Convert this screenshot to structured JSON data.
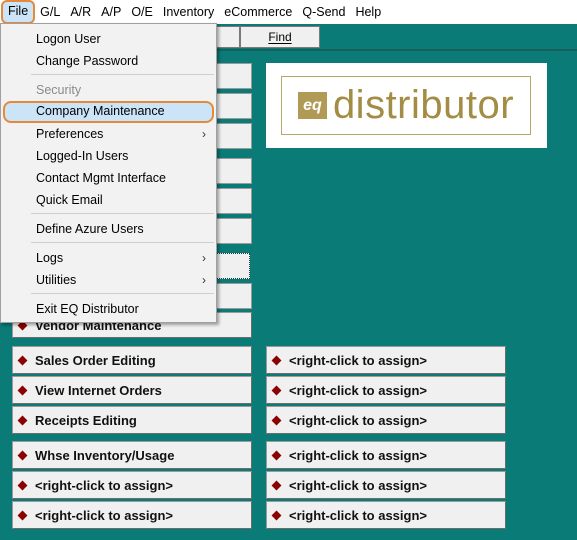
{
  "menubar": {
    "items": [
      "File",
      "G/L",
      "A/R",
      "A/P",
      "O/E",
      "Inventory",
      "eCommerce",
      "Q-Send",
      "Help"
    ]
  },
  "toolbar": {
    "find_label": "Find"
  },
  "logo": {
    "mark": "eq",
    "text": "distributor"
  },
  "file_menu": {
    "items": [
      {
        "label": "Logon User"
      },
      {
        "label": "Change Password"
      },
      {
        "label": "Security",
        "disabled": true
      },
      {
        "label": "Company Maintenance",
        "highlighted": true
      },
      {
        "label": "Preferences",
        "submenu": true
      },
      {
        "label": "Logged-In Users"
      },
      {
        "label": "Contact Mgmt Interface"
      },
      {
        "label": "Quick Email"
      },
      {
        "label": "Define Azure Users"
      },
      {
        "label": "Logs",
        "submenu": true
      },
      {
        "label": "Utilities",
        "submenu": true
      },
      {
        "label": "Exit EQ Distributor"
      }
    ]
  },
  "shortcuts": {
    "vendor": "Vendor Maintenance",
    "left": [
      "Sales Order Editing",
      "View Internet Orders",
      "Receipts Editing",
      "Whse Inventory/Usage",
      "<right-click to assign>",
      "<right-click to assign>"
    ],
    "right": [
      "<right-click to assign>",
      "<right-click to assign>",
      "<right-click to assign>",
      "<right-click to assign>",
      "<right-click to assign>",
      "<right-click to assign>"
    ]
  },
  "colors": {
    "background": "#0b7b78",
    "highlight_outline": "#e58a3a",
    "diamond": "#8b0000",
    "logo_gold": "#a38c44"
  }
}
